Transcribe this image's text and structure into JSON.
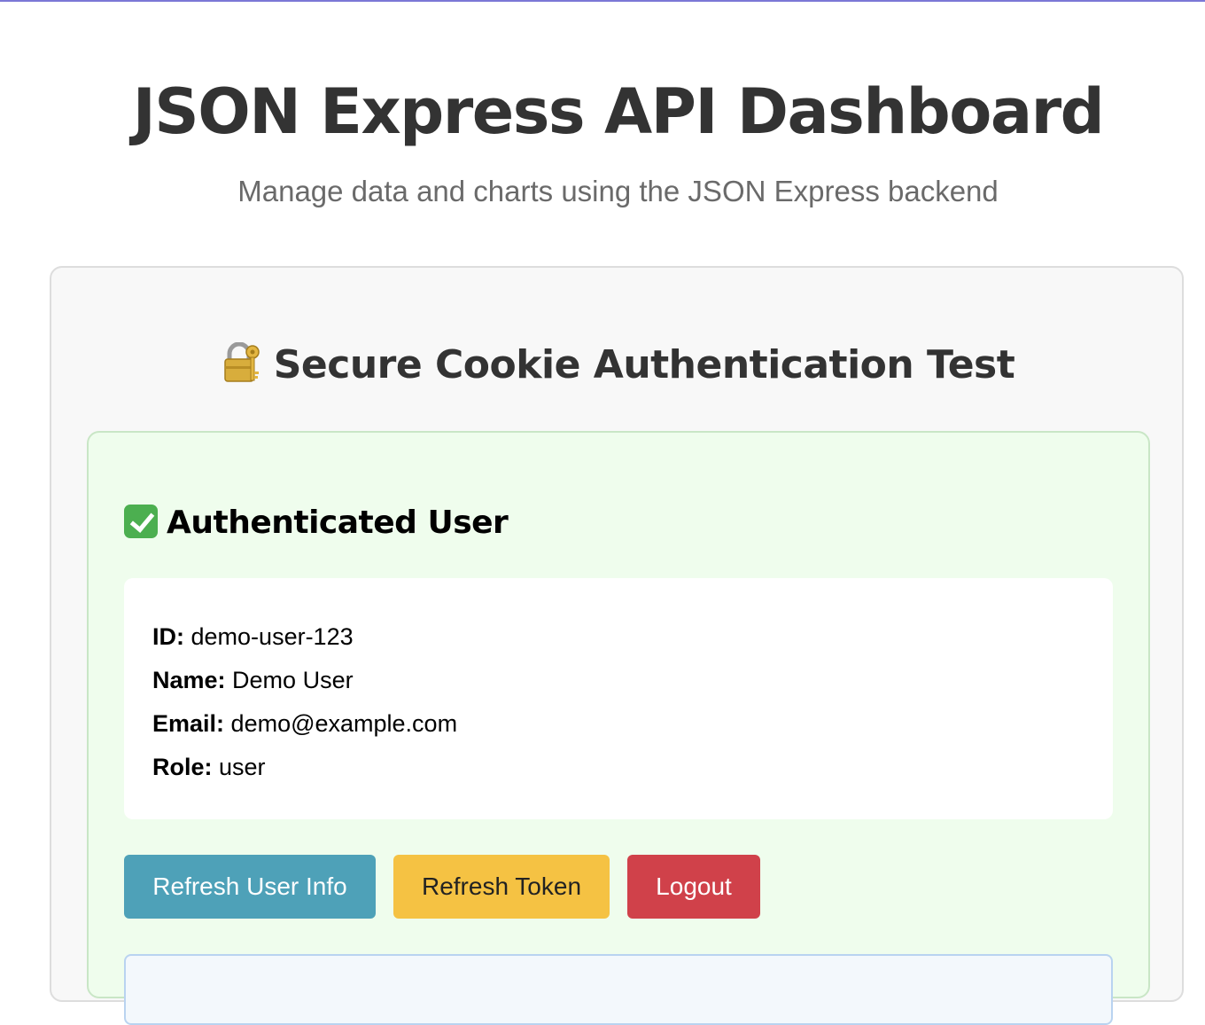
{
  "header": {
    "title": "JSON Express API Dashboard",
    "subtitle": "Manage data and charts using the JSON Express backend"
  },
  "auth_panel": {
    "heading": "Secure Cookie Authentication Test",
    "heading_icon": "lock-with-key-icon",
    "user_card": {
      "heading": "Authenticated User",
      "heading_icon": "check-mark-icon",
      "fields": [
        {
          "label": "ID:",
          "value": "demo-user-123"
        },
        {
          "label": "Name:",
          "value": "Demo User"
        },
        {
          "label": "Email:",
          "value": "demo@example.com"
        },
        {
          "label": "Role:",
          "value": "user"
        }
      ],
      "buttons": {
        "refresh_user_info": "Refresh User Info",
        "refresh_token": "Refresh Token",
        "logout": "Logout"
      }
    }
  },
  "colors": {
    "refresh_user_button": "#4ea1b8",
    "refresh_token_button": "#f5c243",
    "logout_button": "#d0414a",
    "authenticated_card_bg": "#effded",
    "top_border": "#7b78d6"
  }
}
